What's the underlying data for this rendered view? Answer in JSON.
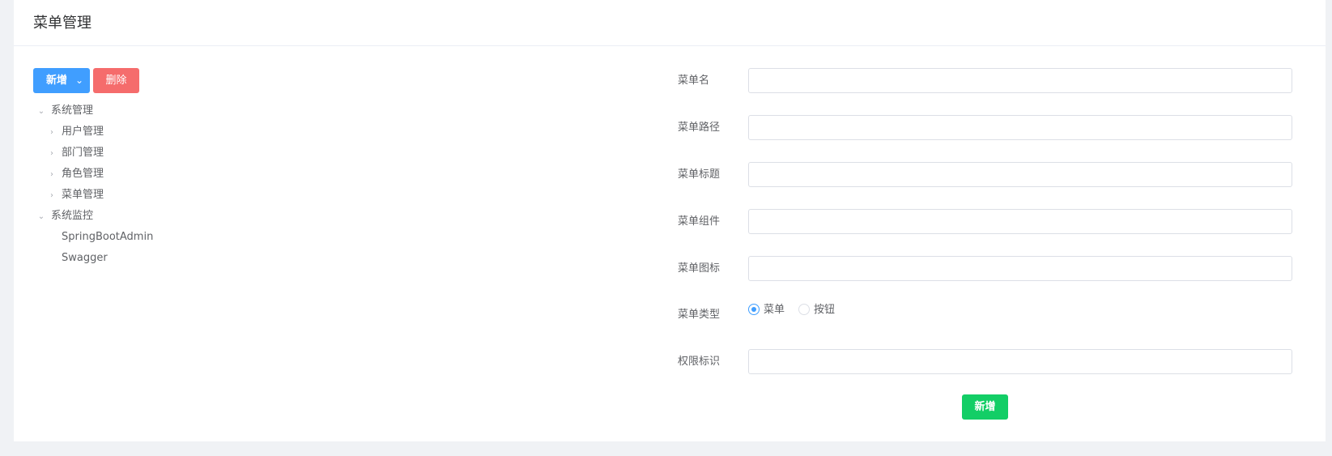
{
  "header": {
    "title": "菜单管理"
  },
  "toolbar": {
    "add_label": "新增",
    "delete_label": "删除"
  },
  "tree": {
    "nodes": [
      {
        "label": "系统管理",
        "toggle": "expanded"
      },
      {
        "label": "用户管理",
        "toggle": "collapsed"
      },
      {
        "label": "部门管理",
        "toggle": "collapsed"
      },
      {
        "label": "角色管理",
        "toggle": "collapsed"
      },
      {
        "label": "菜单管理",
        "toggle": "collapsed"
      },
      {
        "label": "系统监控",
        "toggle": "expanded"
      },
      {
        "label": "SpringBootAdmin",
        "toggle": "leaf"
      },
      {
        "label": "Swagger",
        "toggle": "leaf"
      }
    ]
  },
  "form": {
    "menu_name_label": "菜单名",
    "menu_name_value": "",
    "menu_path_label": "菜单路径",
    "menu_path_value": "",
    "menu_title_label": "菜单标题",
    "menu_title_value": "",
    "menu_component_label": "菜单组件",
    "menu_component_value": "",
    "menu_icon_label": "菜单图标",
    "menu_icon_value": "",
    "menu_type_label": "菜单类型",
    "menu_type_options": [
      "菜单",
      "按钮"
    ],
    "menu_type_selected": "菜单",
    "permission_label": "权限标识",
    "permission_value": "",
    "submit_label": "新增"
  },
  "colors": {
    "primary": "#409eff",
    "danger": "#f56c6c",
    "success": "#13ce66",
    "background": "#f0f2f5"
  },
  "icons": {
    "expanded": "chevron-down-icon",
    "collapsed": "chevron-right-icon",
    "dropdown": "caret-down-icon"
  }
}
